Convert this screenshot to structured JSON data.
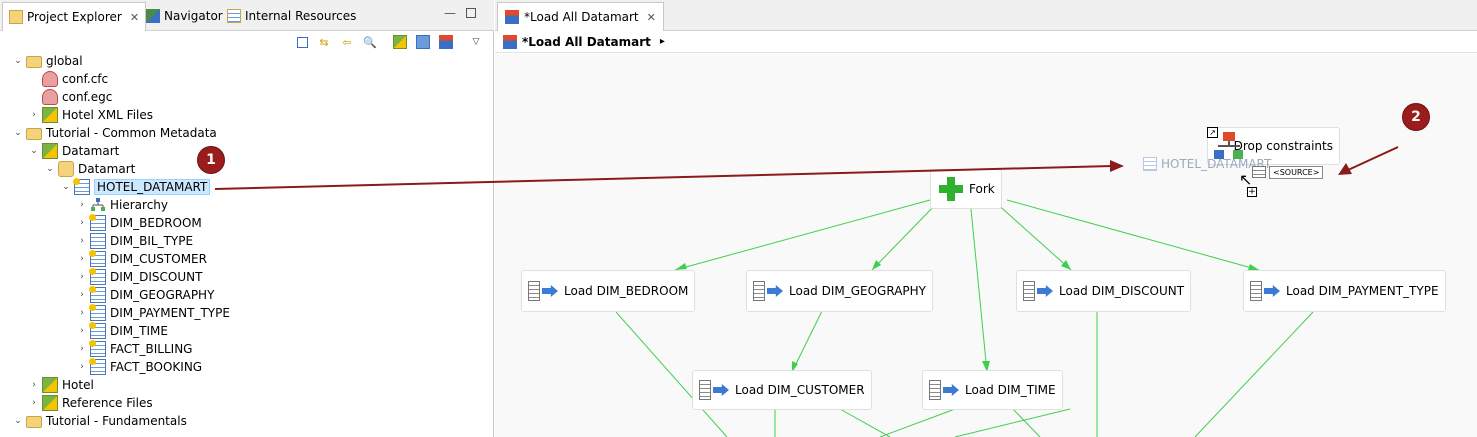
{
  "left_panel": {
    "tabs": [
      {
        "label": "Project Explorer",
        "close": "✕"
      },
      {
        "label": "Navigator"
      },
      {
        "label": "Internal Resources"
      }
    ],
    "window_controls": {
      "minimize": "🗕",
      "maximize": "🗖"
    },
    "tree": [
      {
        "label": "global"
      },
      {
        "label": "conf.cfc"
      },
      {
        "label": "conf.egc"
      },
      {
        "label": "Hotel XML Files"
      },
      {
        "label": "Tutorial - Common Metadata"
      },
      {
        "label": "Datamart"
      },
      {
        "label": "Datamart"
      },
      {
        "label": "HOTEL_DATAMART"
      },
      {
        "label": "Hierarchy"
      },
      {
        "label": "DIM_BEDROOM"
      },
      {
        "label": "DIM_BIL_TYPE"
      },
      {
        "label": "DIM_CUSTOMER"
      },
      {
        "label": "DIM_DISCOUNT"
      },
      {
        "label": "DIM_GEOGRAPHY"
      },
      {
        "label": "DIM_PAYMENT_TYPE"
      },
      {
        "label": "DIM_TIME"
      },
      {
        "label": "FACT_BILLING"
      },
      {
        "label": "FACT_BOOKING"
      },
      {
        "label": "Hotel"
      },
      {
        "label": "Reference Files"
      },
      {
        "label": "Tutorial - Fundamentals"
      }
    ]
  },
  "editor": {
    "tab_label": "*Load All Datamart",
    "tab_close": "✕",
    "breadcrumb": "*Load All Datamart",
    "breadcrumb_arrow": "▸",
    "nodes": {
      "fork": "Fork",
      "drop": "Drop constraints",
      "load_bedroom": "Load DIM_BEDROOM",
      "load_geography": "Load DIM_GEOGRAPHY",
      "load_discount": "Load DIM_DISCOUNT",
      "load_payment": "Load DIM_PAYMENT_TYPE",
      "load_customer": "Load DIM_CUSTOMER",
      "load_time": "Load DIM_TIME"
    },
    "drag_ghost": "HOTEL_DATAMART",
    "source_tag": "<SOURCE>"
  },
  "markers": {
    "one": "1",
    "two": "2"
  },
  "colors": {
    "link": "#3fcf4f",
    "arrow": "#8b1a1a",
    "marker": "#9b1c1c",
    "selection": "#cce8ff"
  }
}
